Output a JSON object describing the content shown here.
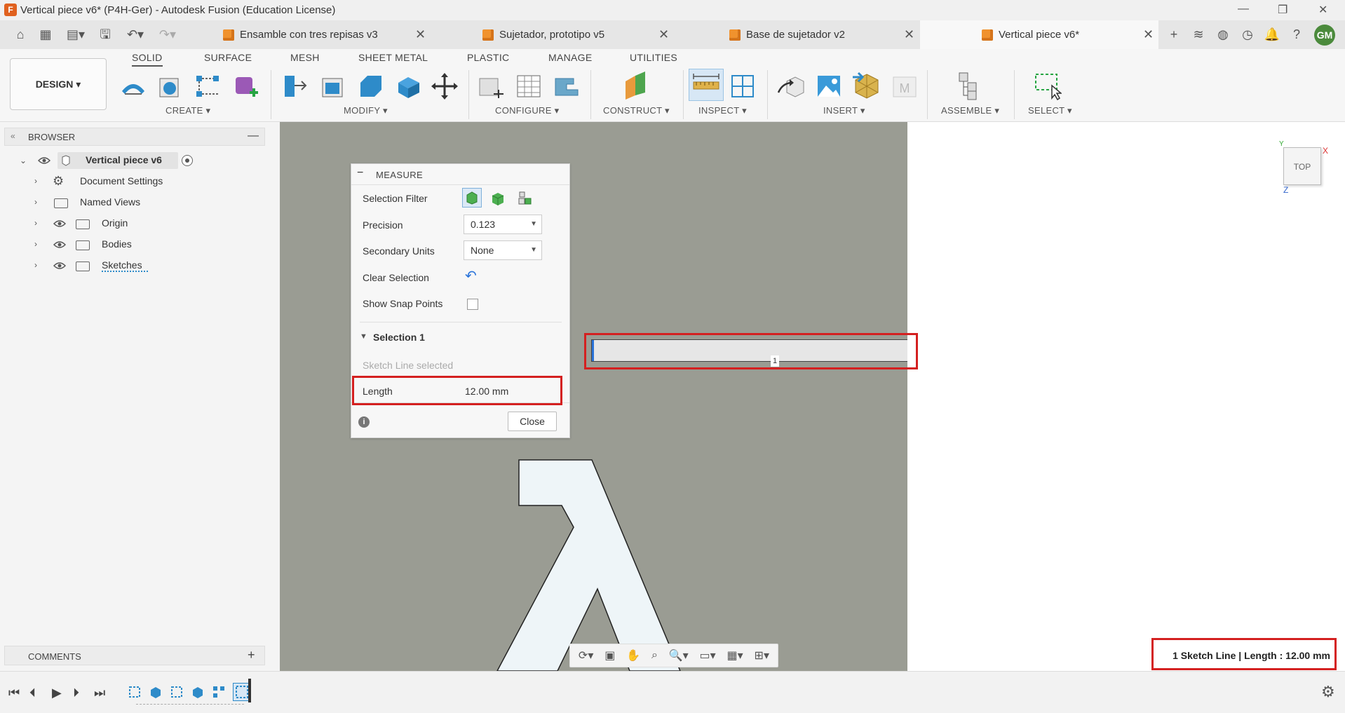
{
  "window": {
    "title": "Vertical piece v6* (P4H-Ger) - Autodesk Fusion (Education License)",
    "app_icon_letter": "F"
  },
  "tabs": [
    {
      "label": "Ensamble con tres repisas v3"
    },
    {
      "label": "Sujetador, prototipo v5"
    },
    {
      "label": "Base de sujetador v2"
    },
    {
      "label": "Vertical piece v6*",
      "active": true
    }
  ],
  "user": {
    "initials": "GM"
  },
  "workspace": {
    "label": "DESIGN"
  },
  "ribbon": {
    "tabs": [
      "SOLID",
      "SURFACE",
      "MESH",
      "SHEET METAL",
      "PLASTIC",
      "MANAGE",
      "UTILITIES"
    ],
    "active_tab": "SOLID",
    "groups": [
      "CREATE",
      "MODIFY",
      "CONFIGURE",
      "CONSTRUCT",
      "INSPECT",
      "INSERT",
      "ASSEMBLE",
      "SELECT"
    ]
  },
  "browser": {
    "title": "BROWSER",
    "root": "Vertical piece v6",
    "items": [
      "Document Settings",
      "Named Views",
      "Origin",
      "Bodies",
      "Sketches"
    ]
  },
  "comments": {
    "title": "COMMENTS"
  },
  "measure": {
    "title": "MEASURE",
    "selection_filter_label": "Selection Filter",
    "precision_label": "Precision",
    "precision_value": "0.123",
    "secondary_units_label": "Secondary Units",
    "secondary_units_value": "None",
    "clear_selection_label": "Clear Selection",
    "show_snap_points_label": "Show Snap Points",
    "show_snap_points_checked": false,
    "selection_header": "Selection 1",
    "selection_info": "Sketch Line selected",
    "length_label": "Length",
    "length_value": "12.00 mm",
    "close_label": "Close"
  },
  "viewport": {
    "selection_marker": "1",
    "glyph": "λ",
    "viewcube_label": "TOP",
    "axis_x": "X",
    "axis_z": "Z",
    "axis_y": "Y"
  },
  "status": {
    "text": "1 Sketch Line | Length : 12.00 mm"
  },
  "colors": {
    "accent_red": "#d42020",
    "viewport_grey": "#9a9c93",
    "fusion_orange": "#f0922d"
  }
}
